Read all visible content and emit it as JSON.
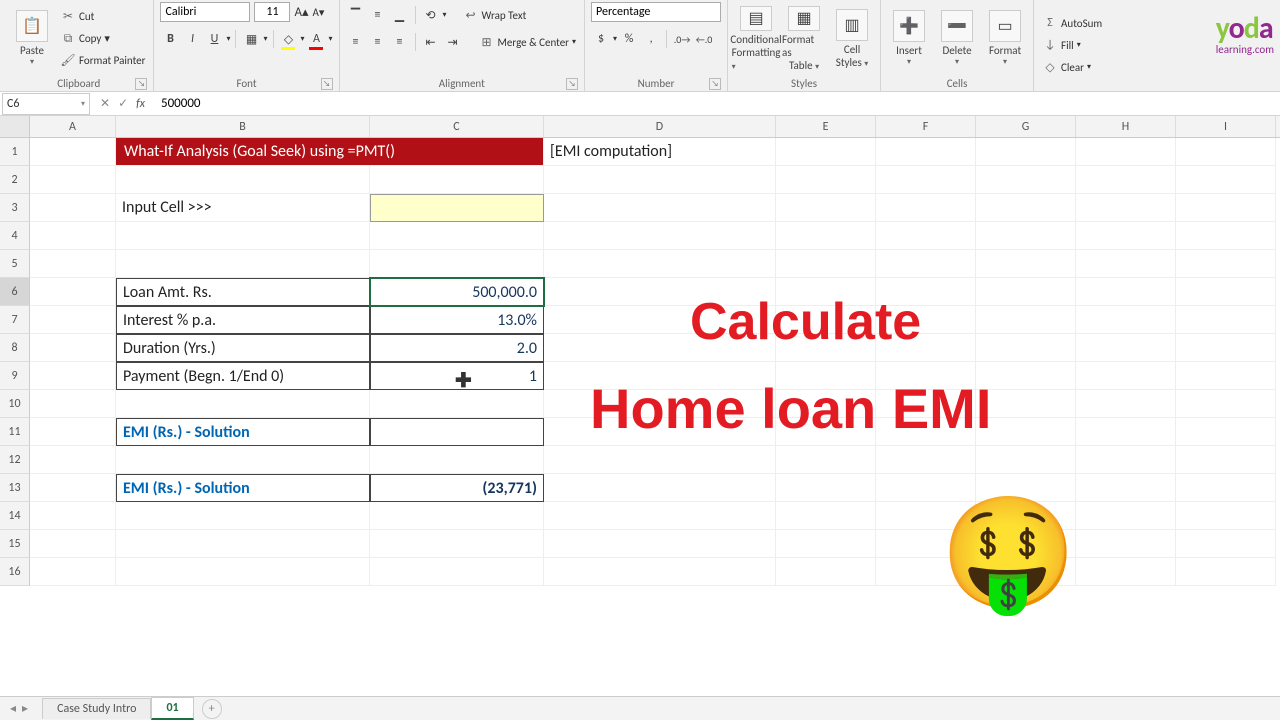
{
  "ribbon": {
    "paste": "Paste",
    "cut": "Cut",
    "copy": "Copy",
    "formatpainter": "Format Painter",
    "clipboard_label": "Clipboard",
    "font_name": "Calibri",
    "font_size": "11",
    "font_label": "Font",
    "wraptext": "Wrap Text",
    "merge": "Merge & Center",
    "alignment_label": "Alignment",
    "numfmt": "Percentage",
    "number_label": "Number",
    "condfmt_l1": "Conditional",
    "condfmt_l2": "Formatting",
    "fmtastable_l1": "Format as",
    "fmtastable_l2": "Table",
    "cellstyles_l1": "Cell",
    "cellstyles_l2": "Styles",
    "styles_label": "Styles",
    "insert": "Insert",
    "delete": "Delete",
    "format": "Format",
    "cells_label": "Cells",
    "autosum": "AutoSum",
    "fill": "Fill",
    "clear": "Clear"
  },
  "logo": {
    "t1": "y",
    "t2": "o",
    "t3": "d",
    "t4": "a",
    "sub": "learning.com"
  },
  "fbar": {
    "name": "C6",
    "value": "500000"
  },
  "cols": [
    "A",
    "B",
    "C",
    "D",
    "E",
    "F",
    "G",
    "H",
    "I"
  ],
  "rows": [
    "1",
    "2",
    "3",
    "4",
    "5",
    "6",
    "7",
    "8",
    "9",
    "10",
    "11",
    "12",
    "13",
    "14",
    "15",
    "16"
  ],
  "sheet": {
    "b1": "What-If Analysis (Goal Seek) using =PMT()",
    "d1": "[EMI computation]",
    "b3": "Input Cell >>>",
    "b6": "Loan Amt. Rs.",
    "c6": "500,000.0",
    "b7": "Interest % p.a.",
    "c7": "13.0%",
    "b8": "Duration (Yrs.)",
    "c8": "2.0",
    "b9": "Payment (Begn. 1/End 0)",
    "c9": "1",
    "b11": "EMI (Rs.) - Solution",
    "b13": "EMI (Rs.) - Solution",
    "c13": "(23,771)"
  },
  "overlay": {
    "line1": "Calculate",
    "line2": "Home loan EMI",
    "emoji": "🤑"
  },
  "tabs": {
    "t1": "Case Study Intro",
    "t2": "01",
    "plus": "+"
  }
}
